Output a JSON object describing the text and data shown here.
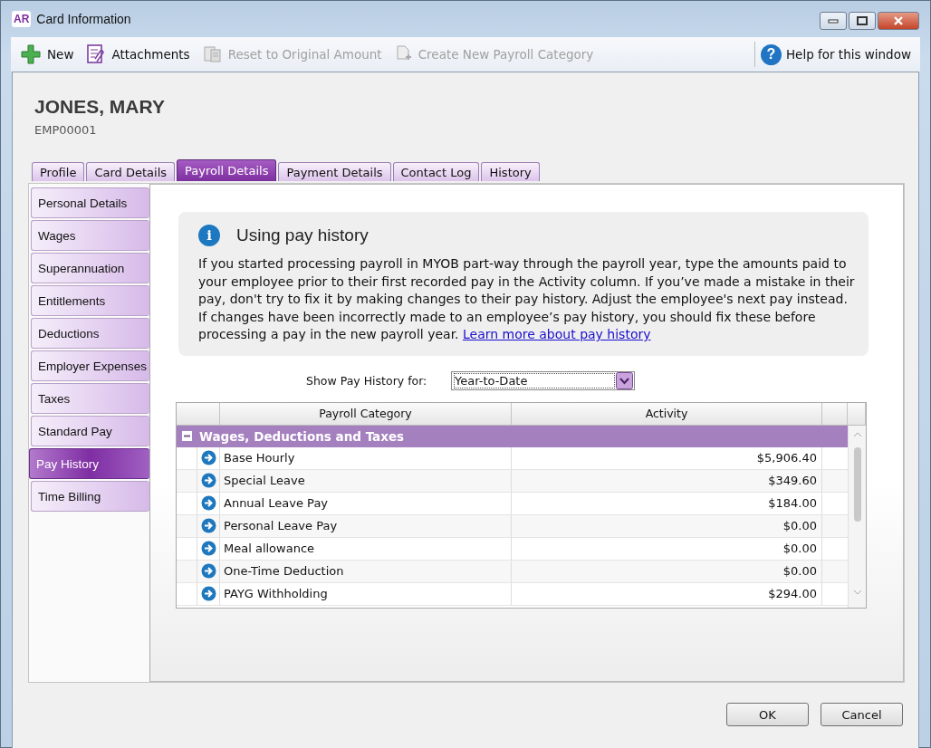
{
  "window": {
    "app_badge": "AR",
    "title": "Card Information"
  },
  "toolbar": [
    {
      "kind": "plus",
      "label": "New",
      "disabled": false
    },
    {
      "kind": "clip",
      "label": "Attachments",
      "disabled": false
    },
    {
      "kind": "doc",
      "label": "Reset to Original Amount",
      "disabled": true
    },
    {
      "kind": "newdoc",
      "label": "Create New Payroll Category",
      "disabled": true
    }
  ],
  "help": {
    "symbol": "?",
    "label": "Help for this window"
  },
  "card": {
    "name": "JONES, MARY",
    "id": "EMP00001"
  },
  "tabs": [
    {
      "label": "Profile",
      "selected": false
    },
    {
      "label": "Card Details",
      "selected": false
    },
    {
      "label": "Payroll Details",
      "selected": true
    },
    {
      "label": "Payment Details",
      "selected": false
    },
    {
      "label": "Contact Log",
      "selected": false
    },
    {
      "label": "History",
      "selected": false
    }
  ],
  "sidebar": {
    "items": [
      {
        "label": "Personal Details",
        "selected": false
      },
      {
        "label": "Wages",
        "selected": false
      },
      {
        "label": "Superannuation",
        "selected": false
      },
      {
        "label": "Entitlements",
        "selected": false
      },
      {
        "label": "Deductions",
        "selected": false
      },
      {
        "label": "Employer Expenses",
        "selected": false
      },
      {
        "label": "Taxes",
        "selected": false
      },
      {
        "label": "Standard Pay",
        "selected": false
      },
      {
        "label": "Pay History",
        "selected": true
      },
      {
        "label": "Time Billing",
        "selected": false
      }
    ]
  },
  "info": {
    "symbol": "i",
    "title": "Using pay history",
    "body": "If you started processing payroll in MYOB part-way through the payroll year, type the amounts paid to your employee prior to their first recorded pay in the Activity column. If you’ve made a mistake in their pay, don't try to fix it by making changes to their pay history. Adjust the employee's next pay instead. If changes have been incorrectly made to an employee’s pay history, you should fix these before processing a pay in the new payroll year.",
    "link": "Learn more about pay history"
  },
  "filter": {
    "label": "Show Pay History for:",
    "value": "Year-to-Date"
  },
  "table": {
    "columns": [
      "Payroll Category",
      "Activity"
    ],
    "groups": [
      {
        "label": "Wages, Deductions and Taxes",
        "expanded": true,
        "rows": [
          {
            "category": "Base Hourly",
            "activity": "$5,906.40"
          },
          {
            "category": "Special Leave",
            "activity": "$349.60"
          },
          {
            "category": "Annual Leave Pay",
            "activity": "$184.00"
          },
          {
            "category": "Personal Leave Pay",
            "activity": "$0.00"
          },
          {
            "category": "Meal allowance",
            "activity": "$0.00"
          },
          {
            "category": "One-Time Deduction",
            "activity": "$0.00"
          },
          {
            "category": "PAYG Withholding",
            "activity": "$294.00"
          }
        ]
      }
    ]
  },
  "buttons": [
    "OK",
    "Cancel"
  ]
}
